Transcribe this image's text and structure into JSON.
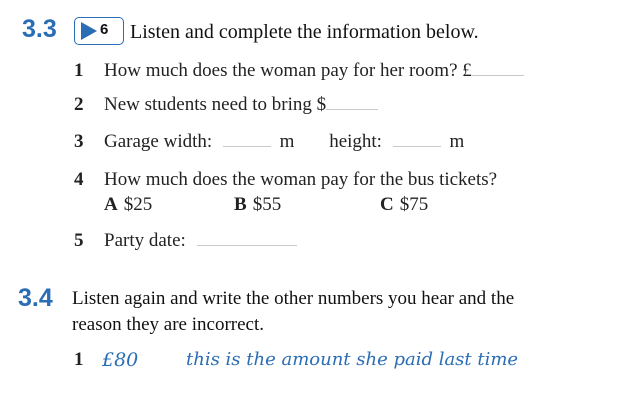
{
  "section1": {
    "number": "3.3",
    "track": "6",
    "instruction": "Listen and complete the information below.",
    "questions": [
      {
        "num": "1",
        "text": "How much does the woman pay for her room? £"
      },
      {
        "num": "2",
        "text": "New students need to bring $"
      },
      {
        "num": "3",
        "text_a": "Garage width:",
        "unit_a": "m",
        "text_b": "height:",
        "unit_b": "m"
      },
      {
        "num": "4",
        "text": "How much does the woman pay for the bus tickets?",
        "options": [
          {
            "letter": "A",
            "value": "$25"
          },
          {
            "letter": "B",
            "value": "$55"
          },
          {
            "letter": "C",
            "value": "$75"
          }
        ]
      },
      {
        "num": "5",
        "text": "Party date:"
      }
    ]
  },
  "section2": {
    "number": "3.4",
    "instruction_line1": "Listen again and write the other numbers you hear and the",
    "instruction_line2": "reason they are incorrect.",
    "example": {
      "num": "1",
      "amount": "£80",
      "reason": "this is the amount she paid last time"
    }
  },
  "colors": {
    "accent": "#2a6db5",
    "text": "#222222"
  },
  "icons": {
    "audio": "play-icon"
  }
}
